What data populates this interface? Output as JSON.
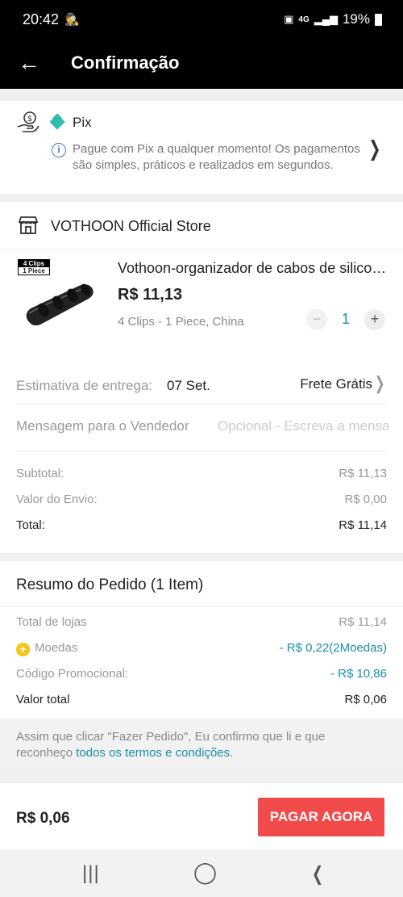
{
  "status": {
    "time": "20:42",
    "net": "4G",
    "battery": "19%"
  },
  "appbar": {
    "title": "Confirmação",
    "back_icon": "arrow-left-icon"
  },
  "payment": {
    "method": "Pix",
    "note": "Pague com Pix a qualquer momento! Os pagamentos são simples, práticos e realizados em segundos."
  },
  "store": {
    "name": "VOTHOON Official Store",
    "product": {
      "tag_line1": "4 Clips",
      "tag_line2": "1 Piece",
      "title": "Vothoon-organizador de cabos de silicone",
      "price": "R$ 11,13",
      "variant": "4 Clips - 1 Piece, China",
      "quantity": "1",
      "minus": "−",
      "plus": "+"
    },
    "delivery_label": "Estimativa de entrega:",
    "delivery_value": "07 Set.",
    "shipping": "Frete Grátis",
    "message_label": "Mensagem para o Vendedor",
    "message_placeholder": "Opcional - Escreva a mensagem",
    "subtotal_label": "Subtotal:",
    "subtotal_value": "R$ 11,13",
    "shipping_cost_label": "Valor do Envio:",
    "shipping_cost_value": "R$ 0,00",
    "total_label": "Total:",
    "total_value": "R$ 11,14"
  },
  "summary": {
    "heading": "Resumo do Pedido (1 Item)",
    "stores_label": "Total de lojas",
    "stores_value": "R$ 11,14",
    "coins_label": "Moedas",
    "coins_value": "- R$ 0,22(2Moedas)",
    "promo_label": "Código Promocional:",
    "promo_value": "- R$ 10,86",
    "total_label": "Valor total",
    "total_value": "R$ 0,06"
  },
  "terms": {
    "text": "Assim que clicar \"Fazer Pedido\", Eu confirmo que li e que reconheço ",
    "link": "todos os termos e condições",
    "end": "."
  },
  "bottom": {
    "total": "R$ 0,06",
    "pay_button": "PAGAR AGORA"
  },
  "colors": {
    "accent": "#f04a4a",
    "teal": "#1a8fa8",
    "pix": "#32bcad",
    "coin": "#f5c518"
  }
}
